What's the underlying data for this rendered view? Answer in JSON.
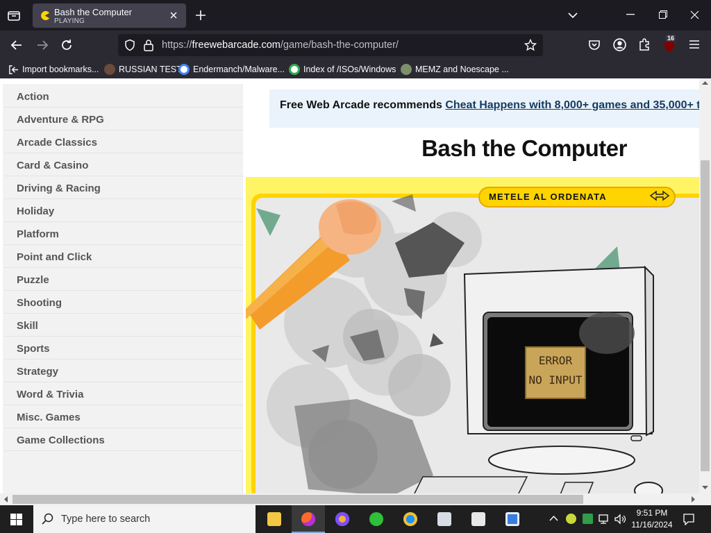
{
  "browser": {
    "tab": {
      "title": "Bash the Computer",
      "subtitle": "PLAYING"
    },
    "url": {
      "scheme": "https://",
      "host": "freewebarcade.com",
      "path": "/game/bash-the-computer/"
    },
    "extension_badge": "16",
    "bookmarks": [
      {
        "label": "Import bookmarks...",
        "icon": "import-icon"
      },
      {
        "label": "RUSSIAN TEST",
        "icon": "avatar-icon"
      },
      {
        "label": "Endermanch/Malware...",
        "icon": "google-icon"
      },
      {
        "label": "Index of /ISOs/Windows",
        "icon": "google-icon"
      },
      {
        "label": "MEMZ and Noescape ...",
        "icon": "globe-icon"
      }
    ]
  },
  "sidebar": {
    "categories": [
      "Action",
      "Adventure & RPG",
      "Arcade Classics",
      "Card & Casino",
      "Driving & Racing",
      "Holiday",
      "Platform",
      "Point and Click",
      "Puzzle",
      "Shooting",
      "Skill",
      "Sports",
      "Strategy",
      "Word & Trivia",
      "Misc. Games",
      "Game Collections"
    ]
  },
  "main": {
    "recommend_prefix": "Free Web Arcade recommends",
    "recommend_link": "Cheat Happens with 8,000+ games and 35,000+ t",
    "game_title": "Bash the Computer",
    "game": {
      "banner": "METELE AL ORDENATA",
      "screen_line1": "ERROR",
      "screen_line2": "NO INPUT"
    }
  },
  "taskbar": {
    "search_placeholder": "Type here to search",
    "time": "9:51 PM",
    "date": "11/16/2024",
    "apps": [
      "file-explorer-icon",
      "firefox-icon",
      "chromium-icon",
      "plus-app-icon",
      "ie-icon",
      "computer-icon",
      "7zip-icon",
      "window-app-icon"
    ]
  },
  "colors": {
    "game_yellow": "#fff463",
    "banner_yellow": "#ffd400",
    "link_blue": "#163a5f"
  }
}
